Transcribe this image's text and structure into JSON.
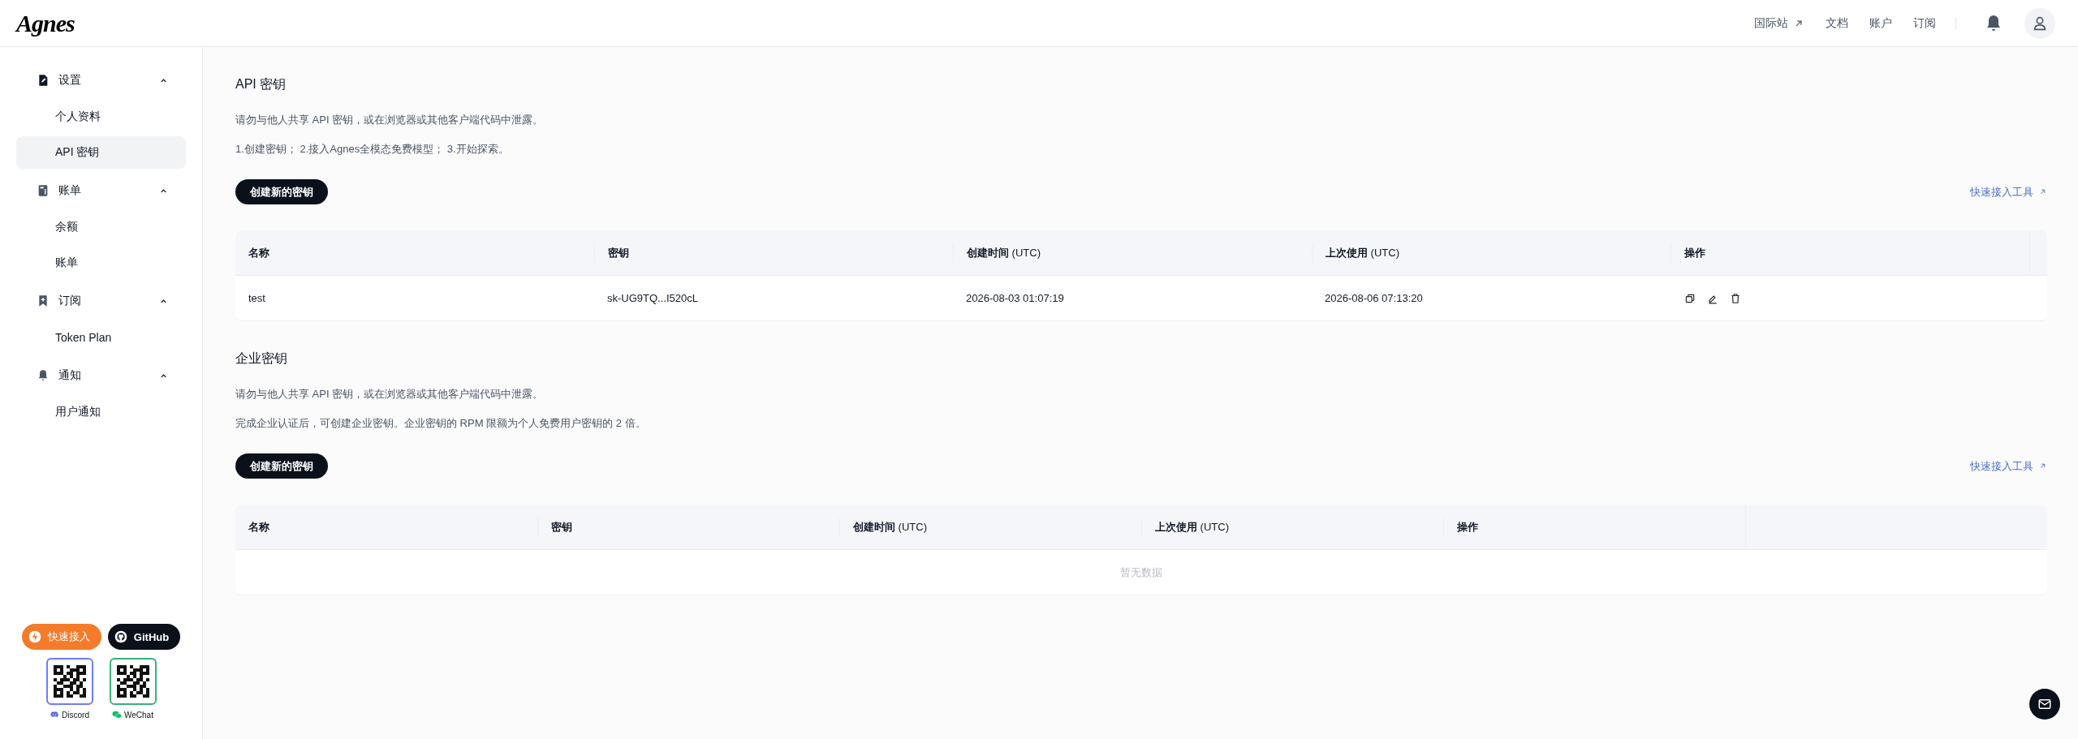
{
  "header": {
    "logo": "Agnes",
    "nav": [
      {
        "label": "国际站",
        "external": true
      },
      {
        "label": "文档",
        "external": false
      },
      {
        "label": "账户",
        "external": false
      },
      {
        "label": "订阅",
        "external": false
      }
    ]
  },
  "sidebar": {
    "groups": [
      {
        "label": "设置",
        "expanded": true,
        "items": [
          {
            "label": "个人资料",
            "selected": false
          },
          {
            "label": "API 密钥",
            "selected": true
          }
        ]
      },
      {
        "label": "账单",
        "expanded": true,
        "items": [
          {
            "label": "余额",
            "selected": false
          },
          {
            "label": "账单",
            "selected": false
          }
        ]
      },
      {
        "label": "订阅",
        "expanded": true,
        "items": [
          {
            "label": "Token Plan",
            "selected": false
          }
        ]
      },
      {
        "label": "通知",
        "expanded": true,
        "items": [
          {
            "label": "用户通知",
            "selected": false
          }
        ]
      }
    ],
    "buttons": [
      {
        "kind": "quick",
        "label": "快速接入"
      },
      {
        "kind": "github",
        "label": "GitHub"
      }
    ],
    "communities": [
      {
        "kind": "discord",
        "label": "Discord"
      },
      {
        "kind": "wechat",
        "label": "WeChat"
      }
    ]
  },
  "sections": [
    {
      "title": "API 密钥",
      "notes": [
        "请勿与他人共享 API 密钥，或在浏览器或其他客户端代码中泄露。",
        "1.创建密钥； 2.接入Agnes全模态免费模型； 3.开始探索。"
      ],
      "button": "创建新的密钥",
      "link": "快速接入工具",
      "table": {
        "columns": [
          "名称",
          "密钥",
          "**创建时间** (UTC)",
          "**上次使用** (UTC)",
          "操作"
        ],
        "rows": [
          {
            "cells": [
              "test",
              "sk-UG9TQ...I520cL",
              "2026-08-03 01:07:19",
              "2026-08-06 07:13:20"
            ]
          }
        ]
      }
    },
    {
      "title": "企业密钥",
      "notes": [
        "请勿与他人共享 API 密钥，或在浏览器或其他客户端代码中泄露。",
        "完成企业认证后，可创建企业密钥。企业密钥的 RPM 限额为个人免费用户密钥的 2 倍。"
      ],
      "button": "创建新的密钥",
      "link": "快速接入工具",
      "table": {
        "columns": [
          "名称",
          "密钥",
          "**创建时间** (UTC)",
          "**上次使用** (UTC)",
          "操作"
        ],
        "empty": "暂无数据"
      }
    }
  ]
}
